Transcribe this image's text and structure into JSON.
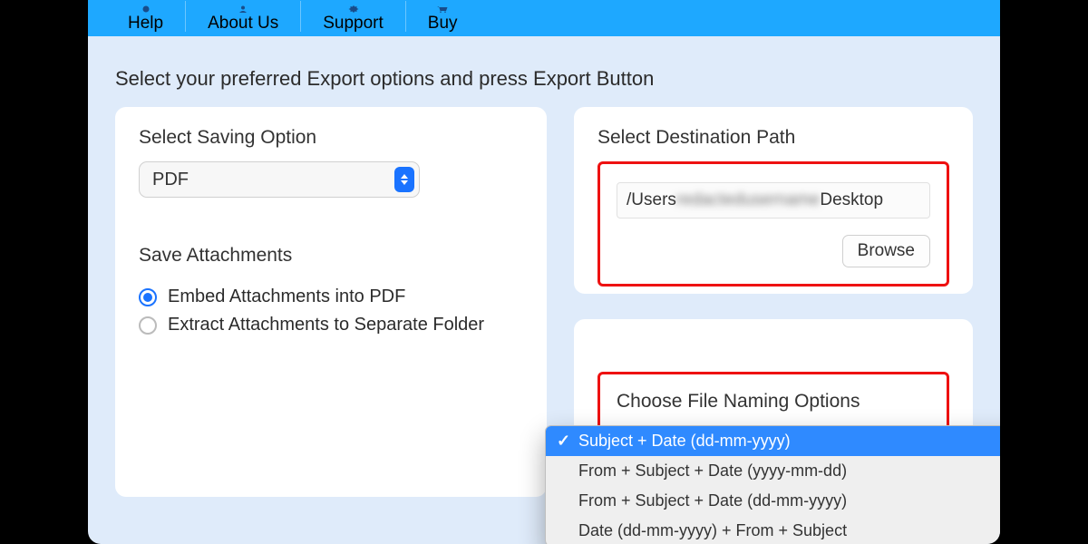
{
  "nav": {
    "items": [
      {
        "label": "Help",
        "icon": "help-icon"
      },
      {
        "label": "About Us",
        "icon": "about-icon"
      },
      {
        "label": "Support",
        "icon": "support-icon"
      },
      {
        "label": "Buy",
        "icon": "buy-icon"
      }
    ]
  },
  "instructions": "Select your preferred Export options and press Export Button",
  "left": {
    "saving_header": "Select Saving Option",
    "format_value": "PDF",
    "attachments_header": "Save Attachments",
    "attach_options": [
      {
        "label": "Embed Attachments into PDF",
        "selected": true
      },
      {
        "label": "Extract Attachments to Separate Folder",
        "selected": false
      }
    ]
  },
  "right": {
    "dest_header": "Select Destination Path",
    "path_prefix": "/Users",
    "path_redacted": "redactedusername",
    "path_suffix": "Desktop",
    "browse_label": "Browse",
    "naming_header": "Choose File Naming Options"
  },
  "naming_menu": {
    "options": [
      {
        "label": "Subject + Date (dd-mm-yyyy)",
        "selected": true
      },
      {
        "label": "From + Subject + Date (yyyy-mm-dd)",
        "selected": false
      },
      {
        "label": "From + Subject + Date (dd-mm-yyyy)",
        "selected": false
      },
      {
        "label": "Date (dd-mm-yyyy) + From + Subject",
        "selected": false
      }
    ]
  },
  "colors": {
    "accent": "#1ea8ff",
    "highlight": "#e11",
    "select": "#2f8aff"
  }
}
